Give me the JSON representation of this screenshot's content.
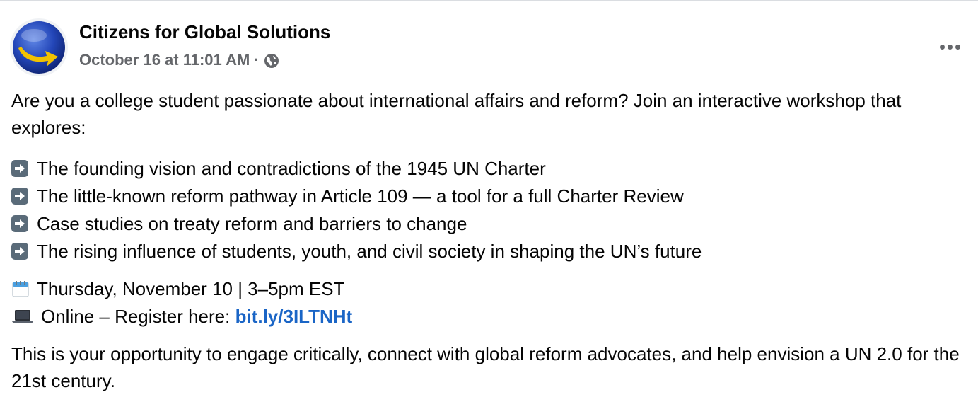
{
  "post": {
    "author": "Citizens for Global Solutions",
    "timestamp": "October 16 at 11:01 AM",
    "separator": "·",
    "audience_icon": "globe-icon",
    "more_icon": "more-options-icon",
    "intro": "Are you a college student passionate about international affairs and reform? Join an interactive workshop that explores:",
    "list_items": [
      "The founding vision and contradictions of the 1945 UN Charter",
      "The little-known reform pathway in Article 109 — a tool for a full Charter Review",
      "Case studies on treaty reform and barriers to change",
      "The rising influence of students, youth, and civil society in shaping the UN’s future"
    ],
    "event_date": "Thursday, November 10 | 3–5pm EST",
    "event_location_prefix": "Online – Register here: ",
    "event_link": "bit.ly/3ILTNHt",
    "closing": "This is your opportunity to engage critically, connect with global reform advocates, and help envision a UN 2.0 for the 21st century."
  },
  "colors": {
    "text": "#050505",
    "secondary": "#65676b",
    "link": "#1a65c6",
    "avatar_blue": "#1e3fa8",
    "avatar_yellow": "#f2c200"
  }
}
